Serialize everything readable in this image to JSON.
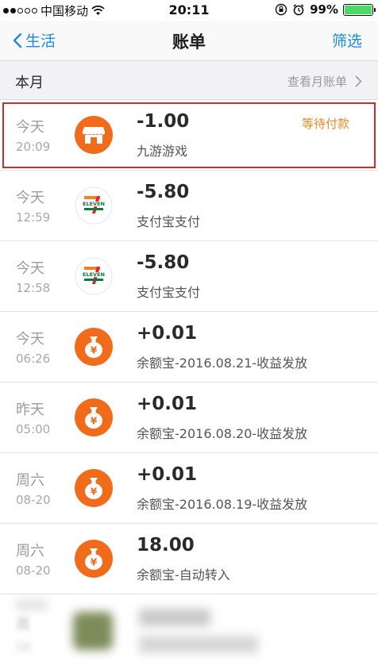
{
  "status_bar": {
    "carrier": "中国移动",
    "time": "20:11",
    "battery": "99%",
    "battery_level": 0.99
  },
  "nav": {
    "back_label": "生活",
    "title": "账单",
    "filter_label": "筛选"
  },
  "section": {
    "title": "本月",
    "monthly_link": "查看月账单"
  },
  "transactions": [
    {
      "day": "今天",
      "time": "20:09",
      "amount": "-1.00",
      "desc": "九游游戏",
      "status": "等待付款",
      "icon": "store-icon"
    },
    {
      "day": "今天",
      "time": "12:59",
      "amount": "-5.80",
      "desc": "支付宝支付",
      "status": "",
      "icon": "seven-eleven-icon"
    },
    {
      "day": "今天",
      "time": "12:58",
      "amount": "-5.80",
      "desc": "支付宝支付",
      "status": "",
      "icon": "seven-eleven-icon"
    },
    {
      "day": "今天",
      "time": "06:26",
      "amount": "+0.01",
      "desc": "余额宝-2016.08.21-收益发放",
      "status": "",
      "icon": "money-bag-icon"
    },
    {
      "day": "昨天",
      "time": "05:00",
      "amount": "+0.01",
      "desc": "余额宝-2016.08.20-收益发放",
      "status": "",
      "icon": "money-bag-icon"
    },
    {
      "day": "周六",
      "time": "08-20",
      "amount": "+0.01",
      "desc": "余额宝-2016.08.19-收益发放",
      "status": "",
      "icon": "money-bag-icon"
    },
    {
      "day": "周六",
      "time": "08-20",
      "amount": "18.00",
      "desc": "余额宝-自动转入",
      "status": "",
      "icon": "money-bag-icon"
    }
  ],
  "blurred": {
    "day": "周",
    "time": "08"
  },
  "colors": {
    "accent_blue": "#1b8ae6",
    "icon_orange": "#f06c1b",
    "status_orange": "#f08a1e",
    "highlight_red": "#d22b2b"
  }
}
